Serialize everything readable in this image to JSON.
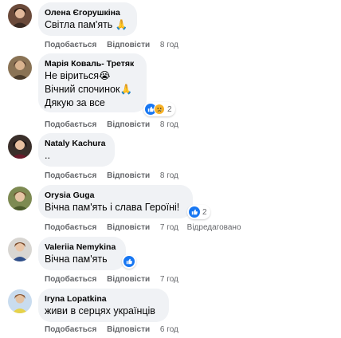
{
  "actions": {
    "like": "Подобається",
    "reply": "Відповісти"
  },
  "comments": [
    {
      "author": "Олена Єгорушкіна",
      "lines": [
        "Світла пам'ять 🙏"
      ],
      "time": "8 год"
    },
    {
      "author": "Марія Коваль- Третяк",
      "lines": [
        "Не віриться😭",
        "Вічний спочинок🙏",
        "Дякую за все"
      ],
      "time": "8 год",
      "reaction_count": "2"
    },
    {
      "author": "Nataly Kachura",
      "lines": [
        ".."
      ],
      "time": "8 год"
    },
    {
      "author": "Orysia Guga",
      "lines": [
        "Вічна пам'ять і слава Героїні!"
      ],
      "time": "7 год",
      "edited": "Відредаговано",
      "reaction_count": "2"
    },
    {
      "author": "Valeriia Nemykina",
      "lines": [
        "Вічна пам'ять"
      ],
      "time": "7 год"
    },
    {
      "author": "Iryna Lopatkina",
      "lines": [
        "живи в серцях українців"
      ],
      "time": "6 год"
    }
  ],
  "icons": {
    "like": "like-icon",
    "sad": "sad-icon"
  },
  "colors": {
    "bubble": "#f0f2f5",
    "like_blue": "#1877f2",
    "meta_gray": "#65676b"
  }
}
